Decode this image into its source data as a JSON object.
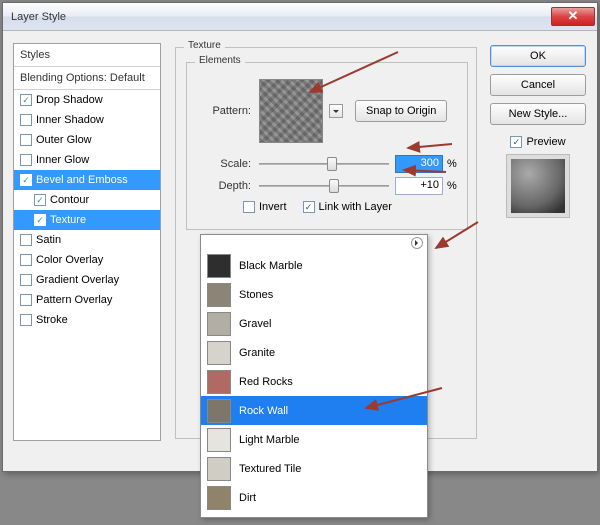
{
  "window": {
    "title": "Layer Style"
  },
  "sidebar": {
    "header_styles": "Styles",
    "header_blend": "Blending Options: Default",
    "items": [
      {
        "label": "Drop Shadow",
        "checked": true,
        "selected": false,
        "sub": false
      },
      {
        "label": "Inner Shadow",
        "checked": false,
        "selected": false,
        "sub": false
      },
      {
        "label": "Outer Glow",
        "checked": false,
        "selected": false,
        "sub": false
      },
      {
        "label": "Inner Glow",
        "checked": false,
        "selected": false,
        "sub": false
      },
      {
        "label": "Bevel and Emboss",
        "checked": true,
        "selected": true,
        "sub": false
      },
      {
        "label": "Contour",
        "checked": true,
        "selected": false,
        "sub": true
      },
      {
        "label": "Texture",
        "checked": true,
        "selected": true,
        "sub": true
      },
      {
        "label": "Satin",
        "checked": false,
        "selected": false,
        "sub": false
      },
      {
        "label": "Color Overlay",
        "checked": false,
        "selected": false,
        "sub": false
      },
      {
        "label": "Gradient Overlay",
        "checked": false,
        "selected": false,
        "sub": false
      },
      {
        "label": "Pattern Overlay",
        "checked": false,
        "selected": false,
        "sub": false
      },
      {
        "label": "Stroke",
        "checked": false,
        "selected": false,
        "sub": false
      }
    ]
  },
  "texture": {
    "group_label": "Texture",
    "elements_label": "Elements",
    "pattern_label": "Pattern:",
    "snap_label": "Snap to Origin",
    "scale_label": "Scale:",
    "scale_value": "300",
    "scale_unit": "%",
    "depth_label": "Depth:",
    "depth_value": "+10",
    "depth_unit": "%",
    "invert_label": "Invert",
    "invert_checked": false,
    "link_label": "Link with Layer",
    "link_checked": true
  },
  "buttons": {
    "ok": "OK",
    "cancel": "Cancel",
    "new_style": "New Style...",
    "preview_label": "Preview",
    "preview_checked": true
  },
  "dropdown": {
    "items": [
      {
        "label": "Black Marble",
        "swatch": "#2e2e2e"
      },
      {
        "label": "Stones",
        "swatch": "#8c8577"
      },
      {
        "label": "Gravel",
        "swatch": "#b3aea3"
      },
      {
        "label": "Granite",
        "swatch": "#d6d3cc"
      },
      {
        "label": "Red Rocks",
        "swatch": "#b16a63"
      },
      {
        "label": "Rock Wall",
        "swatch": "#7e7668"
      },
      {
        "label": "Light Marble",
        "swatch": "#e6e4df"
      },
      {
        "label": "Textured Tile",
        "swatch": "#d0cdc4"
      },
      {
        "label": "Dirt",
        "swatch": "#8f846a"
      }
    ],
    "selected_index": 5
  }
}
